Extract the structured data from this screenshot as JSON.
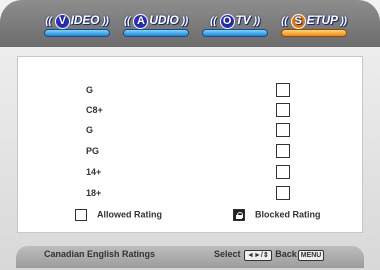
{
  "tabs": [
    {
      "badge": "V",
      "label": "IDEO",
      "active": false
    },
    {
      "badge": "A",
      "label": "UDIO",
      "active": false
    },
    {
      "badge": "O",
      "label": "TV",
      "active": false
    },
    {
      "badge": "S",
      "label": "ETUP",
      "active": true
    }
  ],
  "ratings": [
    {
      "label": "G",
      "blocked": false
    },
    {
      "label": "C8+",
      "blocked": false
    },
    {
      "label": "G",
      "blocked": false
    },
    {
      "label": "PG",
      "blocked": false
    },
    {
      "label": "14+",
      "blocked": false
    },
    {
      "label": "18+",
      "blocked": false
    }
  ],
  "legend": {
    "allowed_label": "Allowed Rating",
    "blocked_label": "Blocked Rating"
  },
  "footer": {
    "title": "Canadian English Ratings",
    "select_label": "Select",
    "nav_key": "◄►/⇕",
    "back_label": "Back",
    "menu_key": "MENU"
  }
}
